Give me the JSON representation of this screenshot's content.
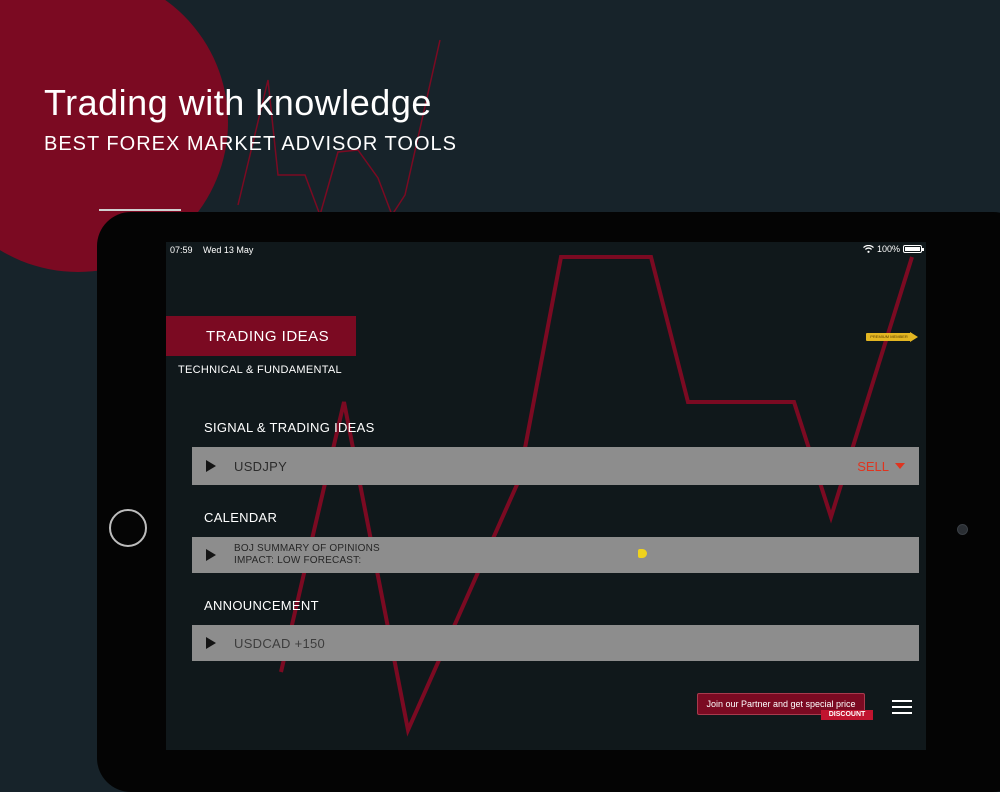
{
  "hero": {
    "title": "Trading with knowledge",
    "subtitle": "BEST FOREX MARKET ADVISOR TOOLS"
  },
  "status_bar": {
    "time": "07:59",
    "date": "Wed 13 May",
    "battery": "100%"
  },
  "section": {
    "title": "TRADING IDEAS",
    "subtitle": "TECHNICAL & FUNDAMENTAL",
    "badge": "PREMIUM MEMBER"
  },
  "signals": {
    "title": "SIGNAL & TRADING IDEAS",
    "pair": "USDJPY",
    "action": "SELL"
  },
  "calendar": {
    "title": "CALENDAR",
    "event_line1": "BOJ SUMMARY OF OPINIONS",
    "event_line2": "IMPACT: LOW FORECAST:"
  },
  "announcement": {
    "title": "ANNOUNCEMENT",
    "text": "USDCAD +150"
  },
  "promo": {
    "text": "Join our Partner and get special price",
    "ribbon": "DISCOUNT"
  },
  "colors": {
    "background": "#17232a",
    "accent": "#7b0a22",
    "row": "#8d8d8d",
    "sell": "#e0341f",
    "tag": "#efd21d"
  },
  "icons": [
    "wifi-icon",
    "battery-icon",
    "play-icon",
    "caret-down-icon",
    "tag-icon",
    "menu-icon"
  ]
}
